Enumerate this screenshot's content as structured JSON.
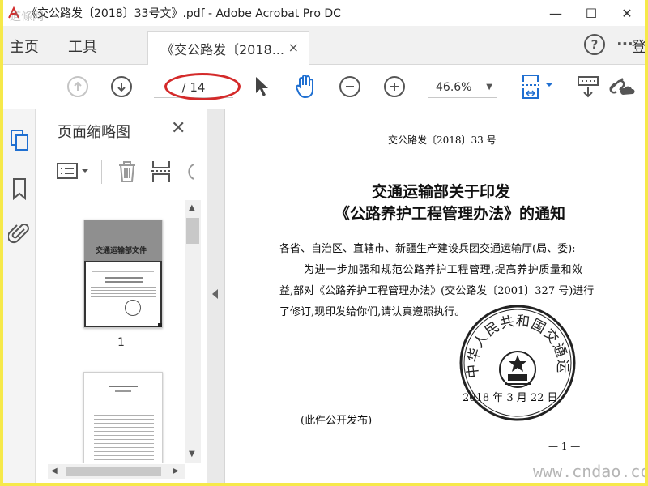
{
  "window": {
    "title": "《交公路发〔2018〕33号文》.pdf - Adobe Acrobat Pro DC",
    "minimize": "—",
    "maximize": "☐",
    "close": "✕"
  },
  "tabs": {
    "home_label": "主页",
    "tools_label": "工具",
    "document_tab": "《交公路发〔2018...",
    "document_tab_close": "×",
    "help": "?",
    "more": "···",
    "login_label": "登"
  },
  "toolbar": {
    "page_indicator": "/ 14",
    "zoom_value": "46.6%"
  },
  "thumbnail_panel": {
    "title": "页面缩略图",
    "close": "✕",
    "thumbnails": [
      {
        "label": "1"
      }
    ],
    "thumb1_header": "交通运输部文件"
  },
  "document": {
    "doc_number": "交公路发〔2018〕33 号",
    "title_line1": "交通运输部关于印发",
    "title_line2": "《公路养护工程管理办法》的通知",
    "addressee": "各省、自治区、直辖市、新疆生产建设兵团交通运输厅(局、委):",
    "body_line1": "为进一步加强和规范公路养护工程管理,提高养护质量和效",
    "body_line2": "益,部对《公路养护工程管理办法》(交公路发〔2001〕327 号)进行",
    "body_line3": "了修订,现印发给你们,请认真遵照执行。",
    "seal_text": "中华人民共和国交通运输部",
    "date": "2018 年 3 月 22 日",
    "footer_note": "(此件公开发布)",
    "page_number": "— 1 —"
  },
  "watermarks": {
    "top_left": "道條网",
    "bottom_right": "www.cndao.com"
  },
  "colors": {
    "accent_blue": "#1f6fd1",
    "highlight_red": "#d42a2a",
    "frame_yellow": "#f6e94a"
  }
}
